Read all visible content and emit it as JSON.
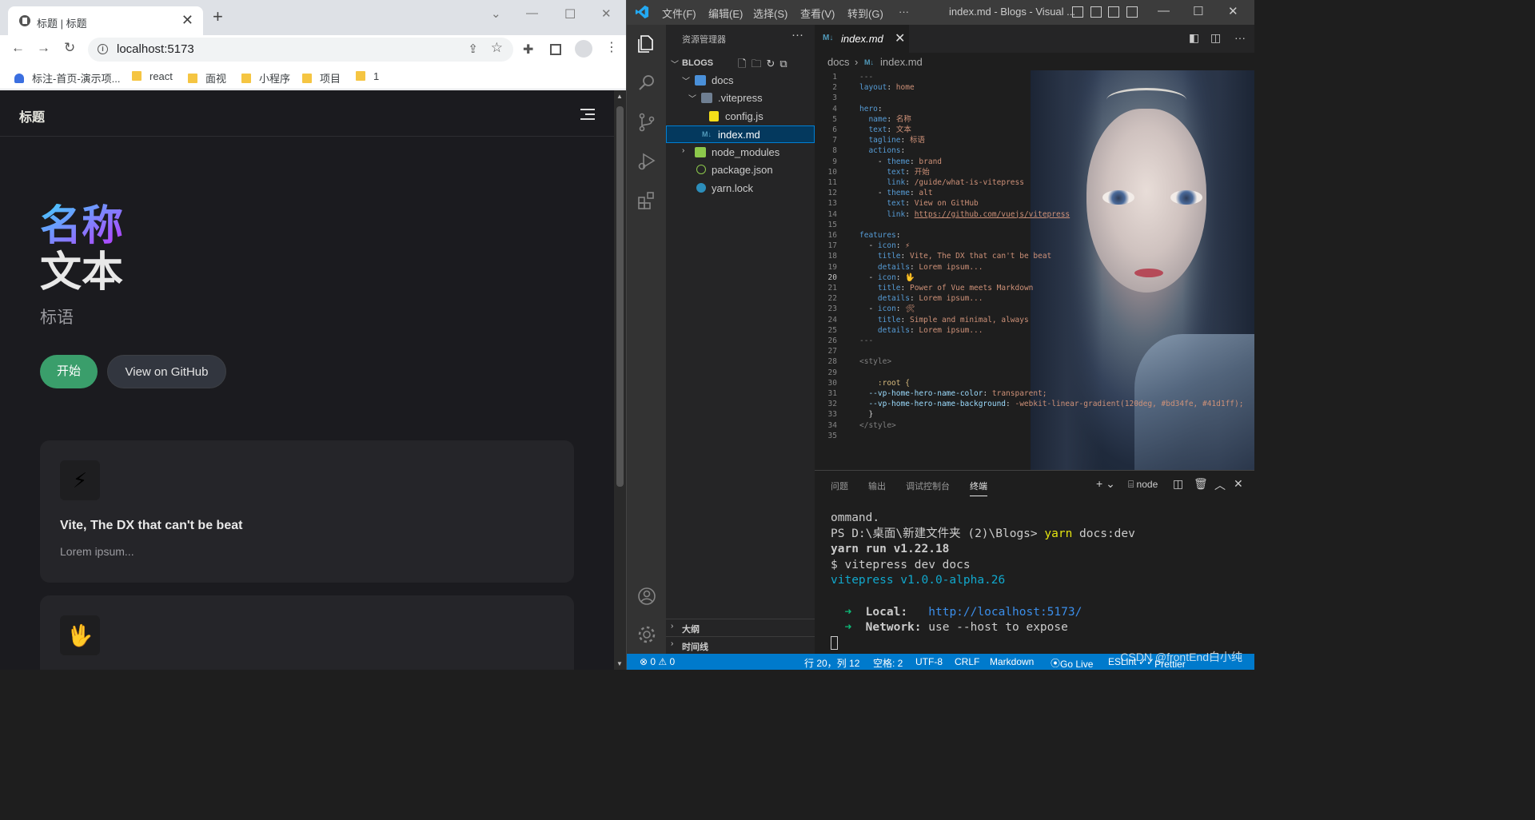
{
  "browser": {
    "tab_title": "标题 | 标题",
    "url": "localhost:5173",
    "bookmarks": [
      "标注-首页-演示项...",
      "react",
      "面视",
      "小程序",
      "项目",
      "1"
    ]
  },
  "site": {
    "nav_title": "标题",
    "hero_name": "名称",
    "hero_text": "文本",
    "tagline": "标语",
    "btn_brand": "开始",
    "btn_alt": "View on GitHub",
    "feature1": {
      "icon": "⚡",
      "title": "Vite, The DX that can't be beat",
      "details": "Lorem ipsum..."
    },
    "feature2": {
      "icon": "🖖"
    },
    "brand_color": "#3a9e6b"
  },
  "vscode": {
    "menus": [
      "文件(F)",
      "编辑(E)",
      "选择(S)",
      "查看(V)",
      "转到(G)",
      "···"
    ],
    "window_title": "index.md - Blogs - Visual ...",
    "explorer_title": "资源管理器",
    "section": "BLOGS",
    "tree": {
      "docs": "docs",
      "vitepress": ".vitepress",
      "config": "config.js",
      "index": "index.md",
      "node_modules": "node_modules",
      "package": "package.json",
      "yarn": "yarn.lock"
    },
    "outline": "大纲",
    "timeline": "时间线",
    "tab": "index.md",
    "crumbs": [
      "docs",
      "index.md"
    ],
    "panel_tabs": [
      "问题",
      "输出",
      "调试控制台",
      "终端"
    ],
    "terminal_shell": "node",
    "terminal_lines": {
      "l1": "ommand.",
      "l2_prefix": "PS D:\\桌面\\新建文件夹 (2)\\Blogs> ",
      "l2_cmd": "yarn",
      "l2_rest": " docs:dev",
      "l3": "yarn run v1.22.18",
      "l4": "$ vitepress dev docs",
      "l5": "vitepress v1.0.0-alpha.26",
      "local_label": "Local:",
      "local_url": "http://localhost:5173/",
      "network_label": "Network:",
      "network_rest": " use --host to expose"
    },
    "status": {
      "errors": "⊗ 0 ⚠ 0",
      "position": "行 20，列 12",
      "spaces": "空格: 2",
      "encoding": "UTF-8",
      "eol": "CRLF",
      "language": "Markdown",
      "golive": "Go Live",
      "eslint": "ESLint",
      "prettier": "Prettier"
    },
    "watermark": "CSDN @frontEnd白小纯",
    "accent": "#007acc"
  },
  "code_lines": [
    "---",
    "layout: home",
    "",
    "hero:",
    "  name: 名称",
    "  text: 文本",
    "  tagline: 标语",
    "  actions:",
    "    - theme: brand",
    "      text: 开始",
    "      link: /guide/what-is-vitepress",
    "    - theme: alt",
    "      text: View on GitHub",
    "      link: https://github.com/vuejs/vitepress",
    "",
    "features:",
    "  - icon: ⚡",
    "    title: Vite, The DX that can't be beat",
    "    details: Lorem ipsum...",
    "  - icon: 🖖",
    "    title: Power of Vue meets Markdown",
    "    details: Lorem ipsum...",
    "  - icon: 🛠",
    "    title: Simple and minimal, always",
    "    details: Lorem ipsum...",
    "---",
    "",
    "<style>",
    "",
    "    :root {",
    "  --vp-home-hero-name-color: transparent;",
    "  --vp-home-hero-name-background: -webkit-linear-gradient(120deg, #bd34fe, #41d1ff);",
    "  }",
    "</style>",
    ""
  ]
}
